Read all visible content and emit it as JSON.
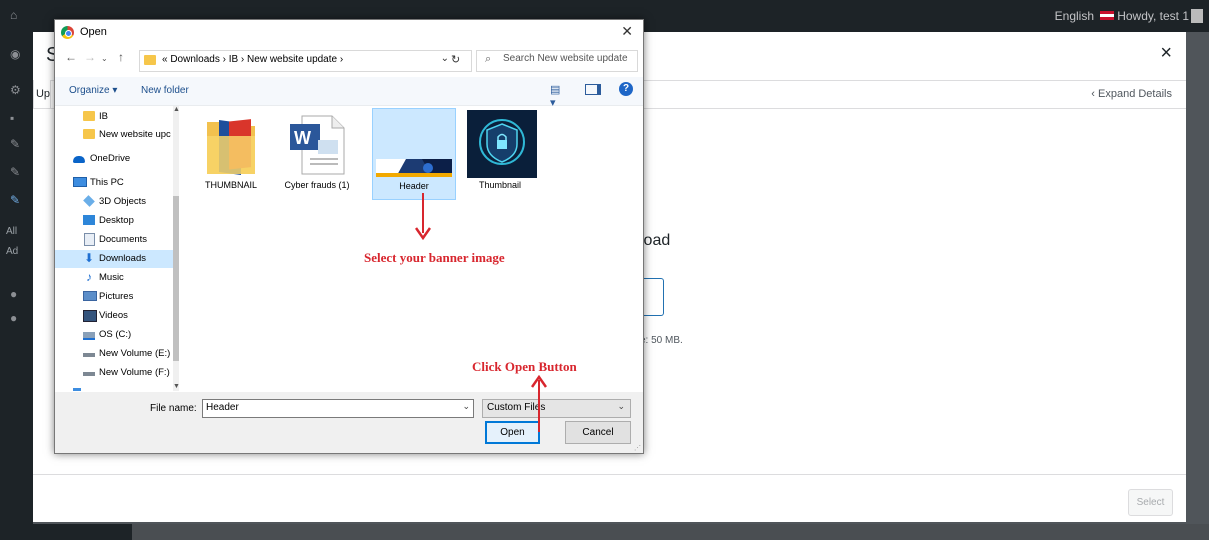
{
  "wp": {
    "admin_bar_language": "English",
    "admin_bar_howdy": "Howdy, test 1",
    "sidebar_all": "All",
    "sidebar_add": "Ad"
  },
  "media_modal": {
    "title_partial": "S",
    "close_glyph": "×",
    "tab_partial": "Up",
    "expand_details": "‹ Expand Details",
    "upload_title_partial": "load",
    "max_size_partial": "e: 50 MB.",
    "select_button": "Select"
  },
  "open_dialog": {
    "title": "Open",
    "close_glyph": "✕",
    "address_path": "«  Downloads  ›  IB  ›  New website update  ›",
    "search_placeholder": "Search New website update",
    "toolbar": {
      "organize": "Organize ▾",
      "new_folder": "New folder"
    },
    "nav_items": [
      {
        "label": "IB",
        "icon": "folder-icon"
      },
      {
        "label": "New website upc",
        "icon": "folder-icon"
      },
      {
        "label": "OneDrive",
        "icon": "onedrive-icon"
      },
      {
        "label": "This PC",
        "icon": "computer-icon"
      },
      {
        "label": "3D Objects",
        "icon": "3d-objects-icon"
      },
      {
        "label": "Desktop",
        "icon": "desktop-icon"
      },
      {
        "label": "Documents",
        "icon": "documents-icon"
      },
      {
        "label": "Downloads",
        "icon": "download-icon"
      },
      {
        "label": "Music",
        "icon": "music-icon"
      },
      {
        "label": "Pictures",
        "icon": "pictures-icon"
      },
      {
        "label": "Videos",
        "icon": "videos-icon"
      },
      {
        "label": "OS (C:)",
        "icon": "drive-icon"
      },
      {
        "label": "New Volume (E:)",
        "icon": "drive-icon"
      },
      {
        "label": "New Volume (F:)",
        "icon": "drive-icon"
      }
    ],
    "files": [
      {
        "name": "THUMBNAIL",
        "type": "folder"
      },
      {
        "name": "Cyber frauds (1)",
        "type": "word-document"
      },
      {
        "name": "Header",
        "type": "image",
        "selected": true
      },
      {
        "name": "Thumbnail",
        "type": "image"
      }
    ],
    "file_name_label": "File name:",
    "file_name_value": "Header",
    "file_type_value": "Custom Files",
    "open_button": "Open",
    "cancel_button": "Cancel"
  },
  "annotations": {
    "select_banner": "Select your banner image",
    "click_open": "Click Open Button"
  },
  "colors": {
    "annotation": "#d8262e",
    "selection": "#cce8ff",
    "accent": "#0078d7"
  }
}
